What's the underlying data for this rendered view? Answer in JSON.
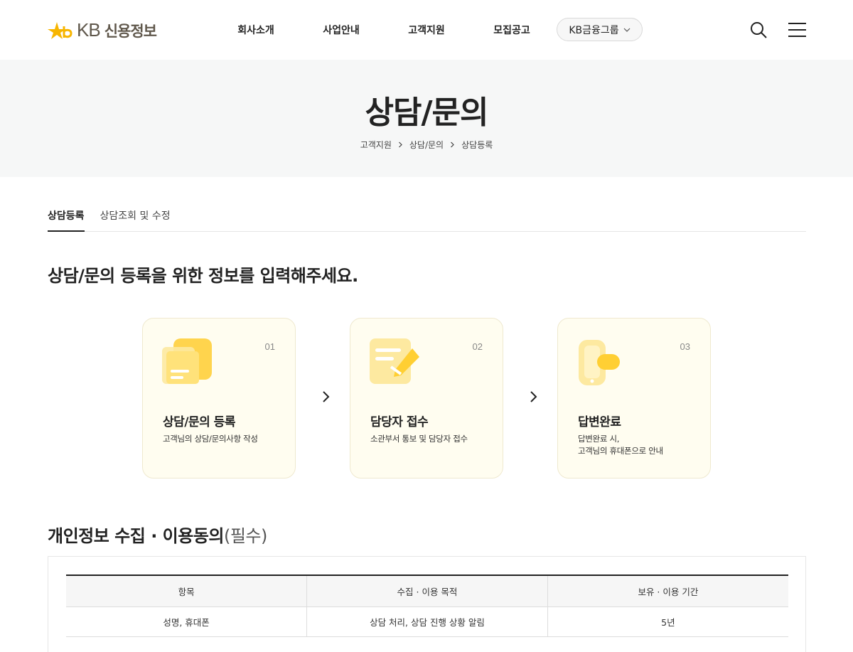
{
  "header": {
    "logo_kb": "KB",
    "logo_sub": "신용정보",
    "nav": [
      "회사소개",
      "사업안내",
      "고객지원",
      "모집공고"
    ],
    "group_button": "KB금융그룹",
    "icons": {
      "search": "search-icon",
      "menu": "hamburger-menu-icon",
      "dropdown": "chevron-down-icon"
    },
    "brand_color": "#f7b500"
  },
  "hero": {
    "title": "상담/문의",
    "breadcrumb": [
      "고객지원",
      "상담/문의",
      "상담등록"
    ]
  },
  "tabs": [
    {
      "label": "상담등록",
      "active": true
    },
    {
      "label": "상담조회 및 수정",
      "active": false
    }
  ],
  "intro": {
    "bold": "상담/문의 등록",
    "rest": "을 위한 정보를 입력해주세요."
  },
  "steps": [
    {
      "num": "01",
      "title": "상담/문의 등록",
      "desc": "고객님의 상담/문의사항 작성",
      "icon": "document-icon"
    },
    {
      "num": "02",
      "title": "담당자 접수",
      "desc": "소관부서 통보 및 담당자 접수",
      "icon": "message-icon"
    },
    {
      "num": "03",
      "title": "답변완료",
      "desc": "답변완료 시,\n고객님의 휴대폰으로 안내",
      "icon": "phone-icon"
    }
  ],
  "privacy": {
    "title": "개인정보 수집 · 이용동의",
    "required": "(필수)",
    "headers": [
      "항목",
      "수집 · 이용 목적",
      "보유 · 이용 기간"
    ],
    "rows": [
      [
        "성명, 휴대폰",
        "상담 처리, 상담 진행 상황 알림",
        "5년"
      ]
    ]
  }
}
